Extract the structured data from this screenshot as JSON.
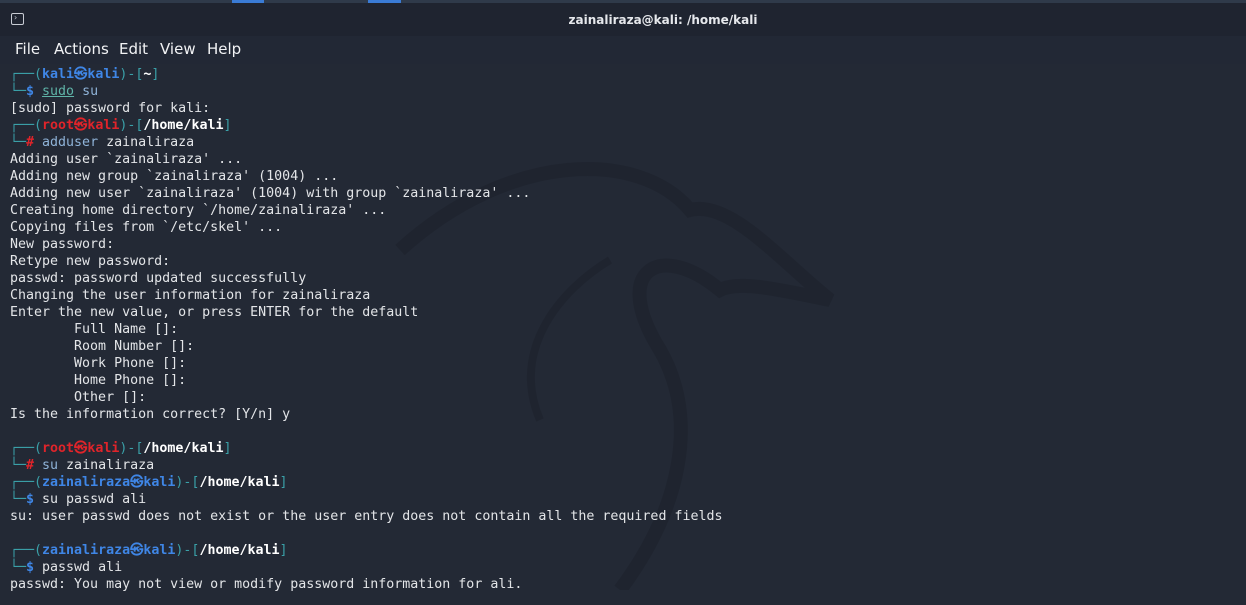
{
  "window": {
    "title": "zainaliraza@kali: /home/kali",
    "icon": "terminal-icon"
  },
  "menu": [
    "File",
    "Actions",
    "Edit",
    "View",
    "Help"
  ],
  "colors": {
    "background": "#232935",
    "user": "#3f86e6",
    "root": "#e0242a",
    "frame": "#3aa0a8"
  },
  "terminal_lines": [
    [
      [
        "┌──(",
        "frame"
      ],
      [
        "kali㉿kali",
        "ubl"
      ],
      [
        ")-[",
        "frame"
      ],
      [
        "~",
        "path"
      ],
      [
        "]",
        "frame"
      ]
    ],
    [
      [
        "└─",
        "frame"
      ],
      [
        "$ ",
        "dollar"
      ],
      [
        "sudo",
        "cmdg"
      ],
      [
        " su",
        "cmdb"
      ]
    ],
    [
      [
        "[sudo] password for kali:",
        "out"
      ]
    ],
    [
      [
        "┌──(",
        "frame"
      ],
      [
        "root㉿kali",
        "ured"
      ],
      [
        ")-[",
        "frame"
      ],
      [
        "/home/kali",
        "path"
      ],
      [
        "]",
        "frame"
      ]
    ],
    [
      [
        "└─",
        "frame"
      ],
      [
        "# ",
        "hash"
      ],
      [
        "adduser",
        "cmdb"
      ],
      [
        " zainaliraza",
        "out"
      ]
    ],
    [
      [
        "Adding user `zainaliraza' ...",
        "out"
      ]
    ],
    [
      [
        "Adding new group `zainaliraza' (1004) ...",
        "out"
      ]
    ],
    [
      [
        "Adding new user `zainaliraza' (1004) with group `zainaliraza' ...",
        "out"
      ]
    ],
    [
      [
        "Creating home directory `/home/zainaliraza' ...",
        "out"
      ]
    ],
    [
      [
        "Copying files from `/etc/skel' ...",
        "out"
      ]
    ],
    [
      [
        "New password:",
        "out"
      ]
    ],
    [
      [
        "Retype new password:",
        "out"
      ]
    ],
    [
      [
        "passwd: password updated successfully",
        "out"
      ]
    ],
    [
      [
        "Changing the user information for zainaliraza",
        "out"
      ]
    ],
    [
      [
        "Enter the new value, or press ENTER for the default",
        "out"
      ]
    ],
    [
      [
        "        Full Name []:",
        "out"
      ]
    ],
    [
      [
        "        Room Number []:",
        "out"
      ]
    ],
    [
      [
        "        Work Phone []:",
        "out"
      ]
    ],
    [
      [
        "        Home Phone []:",
        "out"
      ]
    ],
    [
      [
        "        Other []:",
        "out"
      ]
    ],
    [
      [
        "Is the information correct? [Y/n] y",
        "out"
      ]
    ],
    [],
    [
      [
        "┌──(",
        "frame"
      ],
      [
        "root㉿kali",
        "ured"
      ],
      [
        ")-[",
        "frame"
      ],
      [
        "/home/kali",
        "path"
      ],
      [
        "]",
        "frame"
      ]
    ],
    [
      [
        "└─",
        "frame"
      ],
      [
        "# ",
        "hash"
      ],
      [
        "su",
        "cmdb"
      ],
      [
        " zainaliraza",
        "out"
      ]
    ],
    [
      [
        "┌──(",
        "frame"
      ],
      [
        "zainaliraza㉿kali",
        "ubl"
      ],
      [
        ")-[",
        "frame"
      ],
      [
        "/home/kali",
        "path"
      ],
      [
        "]",
        "frame"
      ]
    ],
    [
      [
        "└─",
        "frame"
      ],
      [
        "$ ",
        "dollar"
      ],
      [
        "su",
        "out"
      ],
      [
        " passwd ali",
        "out"
      ]
    ],
    [
      [
        "su: user passwd does not exist or the user entry does not contain all the required fields",
        "out"
      ]
    ],
    [],
    [
      [
        "┌──(",
        "frame"
      ],
      [
        "zainaliraza㉿kali",
        "ubl"
      ],
      [
        ")-[",
        "frame"
      ],
      [
        "/home/kali",
        "path"
      ],
      [
        "]",
        "frame"
      ]
    ],
    [
      [
        "└─",
        "frame"
      ],
      [
        "$ ",
        "dollar"
      ],
      [
        "passwd",
        "out"
      ],
      [
        " ali",
        "out"
      ]
    ],
    [
      [
        "passwd: You may not view or modify password information for ali.",
        "out"
      ]
    ]
  ]
}
